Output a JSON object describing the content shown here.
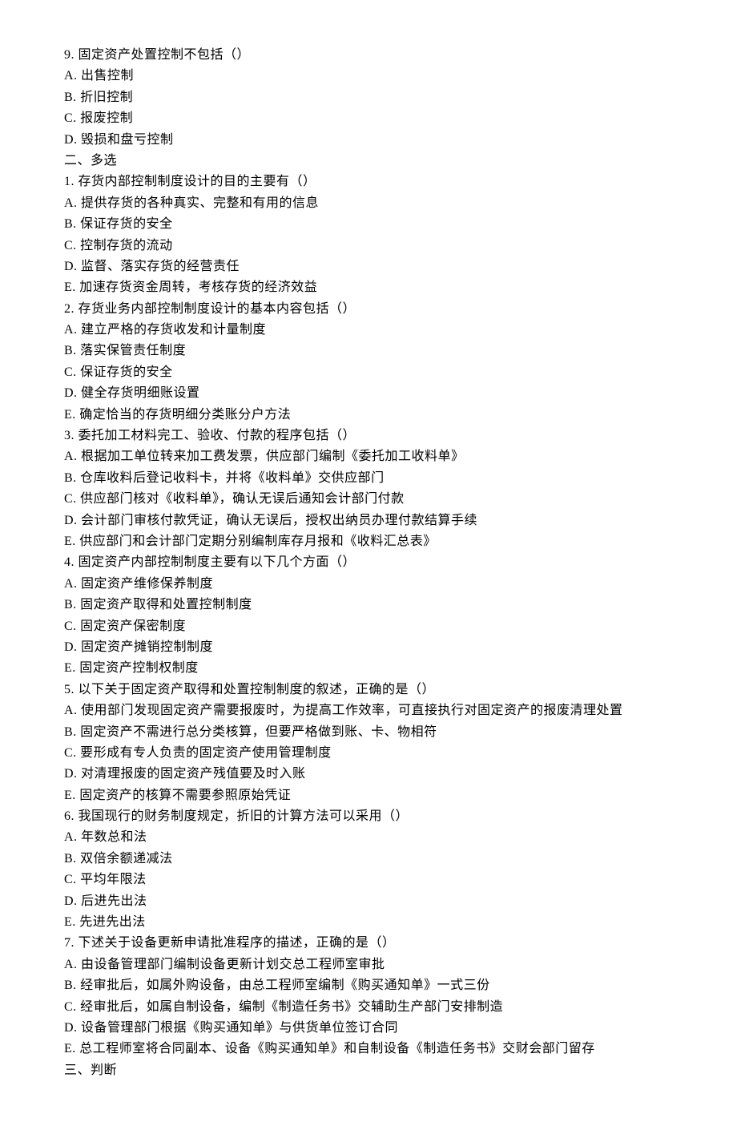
{
  "lines": [
    "9. 固定资产处置控制不包括（）",
    "A. 出售控制",
    "B. 折旧控制",
    "C. 报废控制",
    "D. 毁损和盘亏控制",
    "二、多选",
    "1. 存货内部控制制度设计的目的主要有（）",
    "A. 提供存货的各种真实、完整和有用的信息",
    "B. 保证存货的安全",
    "C. 控制存货的流动",
    "D. 监督、落实存货的经营责任",
    "E. 加速存货资金周转，考核存货的经济效益",
    "2. 存货业务内部控制制度设计的基本内容包括（）",
    "A. 建立严格的存货收发和计量制度",
    "B. 落实保管责任制度",
    "C. 保证存货的安全",
    "D. 健全存货明细账设置",
    "E. 确定恰当的存货明细分类账分户方法",
    "3. 委托加工材料完工、验收、付款的程序包括（）",
    "A. 根据加工单位转来加工费发票，供应部门编制《委托加工收料单》",
    "B. 仓库收料后登记收料卡，并将《收料单》交供应部门",
    "C. 供应部门核对《收料单》，确认无误后通知会计部门付款",
    "D. 会计部门审核付款凭证，确认无误后，授权出纳员办理付款结算手续",
    "E. 供应部门和会计部门定期分别编制库存月报和《收料汇总表》",
    "4. 固定资产内部控制制度主要有以下几个方面（）",
    "A. 固定资产维修保养制度",
    "B. 固定资产取得和处置控制制度",
    "C. 固定资产保密制度",
    "D. 固定资产摊销控制制度",
    "E. 固定资产控制权制度",
    "5. 以下关于固定资产取得和处置控制制度的叙述，正确的是（）",
    "A. 使用部门发现固定资产需要报废时，为提高工作效率，可直接执行对固定资产的报废清理处置",
    "B. 固定资产不需进行总分类核算，但要严格做到账、卡、物相符",
    "C. 要形成有专人负责的固定资产使用管理制度",
    "D. 对清理报废的固定资产残值要及时入账",
    "E. 固定资产的核算不需要参照原始凭证",
    "6. 我国现行的财务制度规定，折旧的计算方法可以采用（）",
    "A. 年数总和法",
    "B. 双倍余额递减法",
    "C. 平均年限法",
    "D. 后进先出法",
    "E. 先进先出法",
    "7. 下述关于设备更新申请批准程序的描述，正确的是（）",
    "A. 由设备管理部门编制设备更新计划交总工程师室审批",
    "B. 经审批后，如属外购设备，由总工程师室编制《购买通知单》一式三份",
    "C. 经审批后，如属自制设备，编制《制造任务书》交辅助生产部门安排制造",
    "D. 设备管理部门根据《购买通知单》与供货单位签订合同",
    "E. 总工程师室将合同副本、设备《购买通知单》和自制设备《制造任务书》交财会部门留存",
    "三、判断"
  ]
}
